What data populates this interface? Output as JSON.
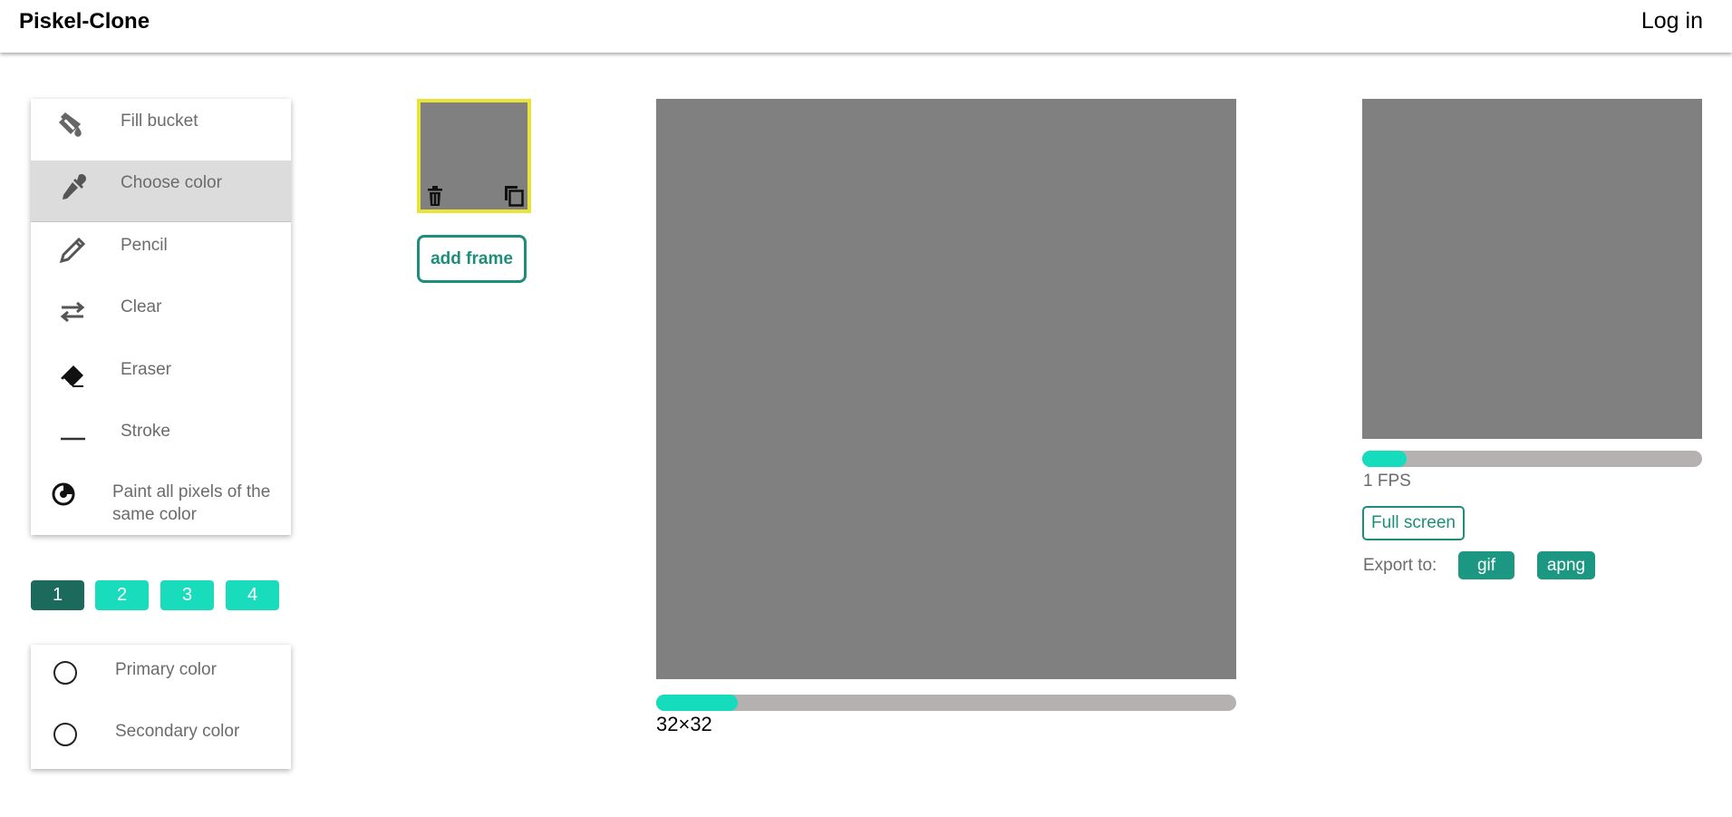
{
  "header": {
    "title": "Piskel-Clone",
    "login_label": "Log in"
  },
  "tools": [
    {
      "label": "Fill bucket",
      "icon": "fill-bucket-icon",
      "active": false
    },
    {
      "label": "Choose color",
      "icon": "eyedropper-icon",
      "active": true
    },
    {
      "label": "Pencil",
      "icon": "pencil-icon",
      "active": false
    },
    {
      "label": "Clear",
      "icon": "swap-arrows-icon",
      "active": false
    },
    {
      "label": "Eraser",
      "icon": "eraser-icon",
      "active": false
    },
    {
      "label": "Stroke",
      "icon": "stroke-line-icon",
      "active": false
    },
    {
      "label": "Paint all pixels of the same color",
      "icon": "paint-all-icon",
      "active": false
    }
  ],
  "pen_sizes": {
    "options": [
      "1",
      "2",
      "3",
      "4"
    ],
    "selected": "1"
  },
  "colors": {
    "primary_label": "Primary color",
    "secondary_label": "Secondary color",
    "primary_value": "#ffffff",
    "secondary_value": "#ffffff"
  },
  "frames": {
    "add_label": "add frame",
    "selected_border": "#e8e43a"
  },
  "canvas": {
    "size_label": "32×32",
    "size_slider_fraction": 0.14,
    "fill": "#808080"
  },
  "preview": {
    "fps_label": "1 FPS",
    "fps_slider_fraction": 0.13,
    "fullscreen_label": "Full screen",
    "export_label": "Export to:",
    "export_options": [
      "gif",
      "apng"
    ]
  },
  "theme": {
    "accent": "#14dcbc",
    "accent_dark": "#1c6a5b",
    "button_teal": "#1c9781",
    "outline_teal": "#1e8e7b"
  }
}
